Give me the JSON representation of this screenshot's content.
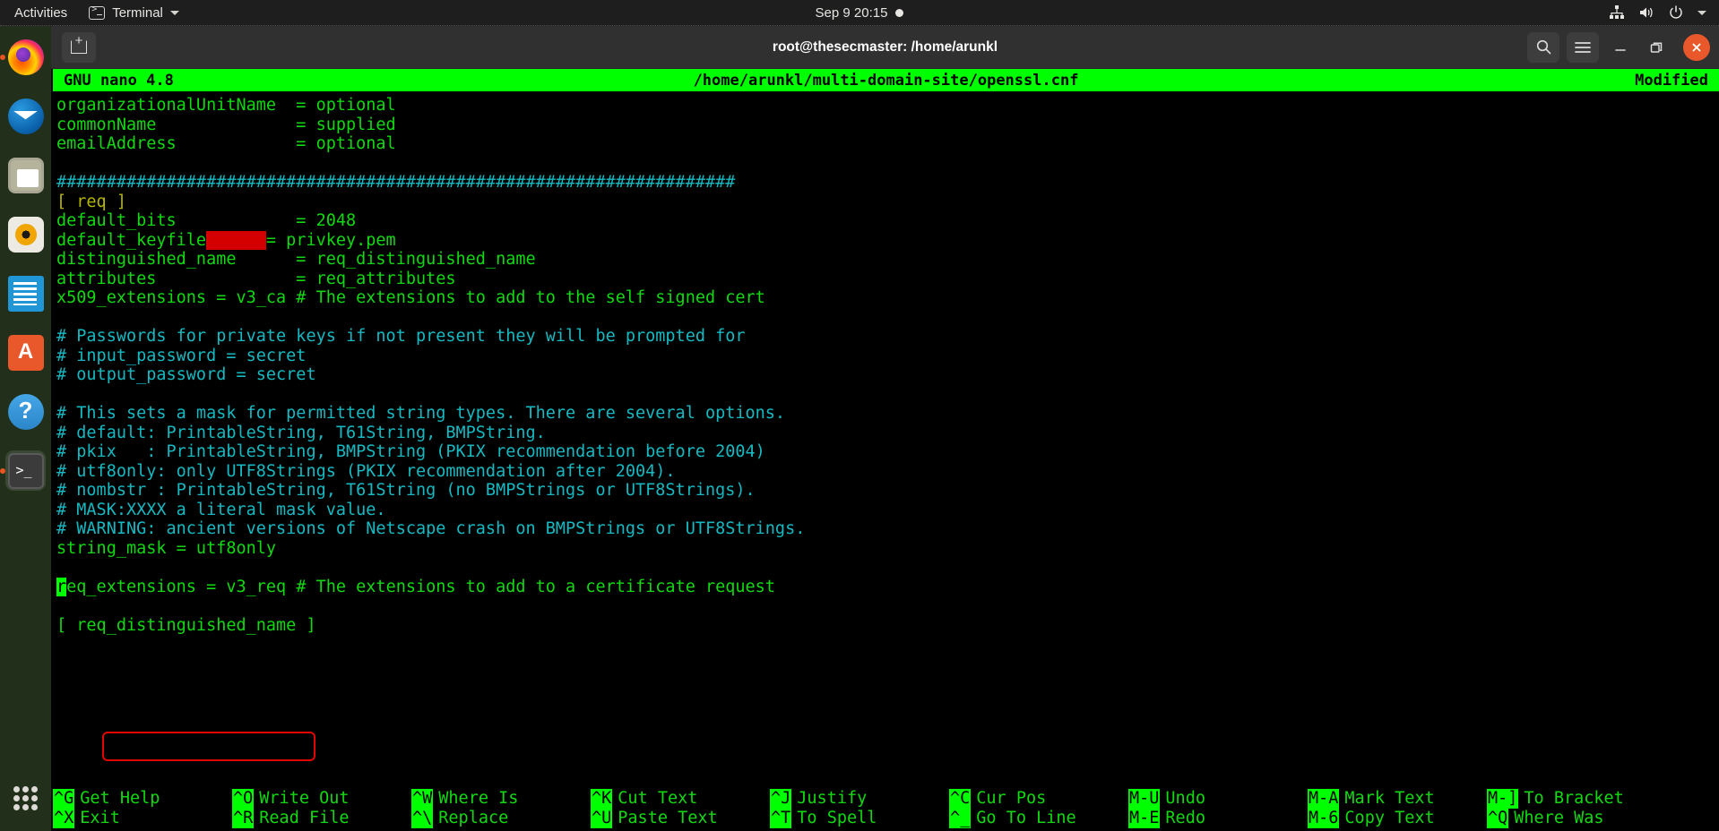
{
  "topbar": {
    "activities": "Activities",
    "app_name": "Terminal",
    "app_icon": "terminal-icon",
    "clock": "Sep 9  20:15",
    "recording_dot": "●",
    "icons": [
      "network-icon",
      "volume-icon",
      "power-icon",
      "chevron-down-icon"
    ]
  },
  "dock": {
    "items": [
      {
        "name": "firefox",
        "label": "Firefox",
        "running": true
      },
      {
        "name": "thunderbird",
        "label": "Thunderbird",
        "running": false
      },
      {
        "name": "files",
        "label": "Files",
        "running": false
      },
      {
        "name": "rhythmbox",
        "label": "Rhythmbox",
        "running": false
      },
      {
        "name": "libreoffice-writer",
        "label": "LibreOffice Writer",
        "running": false
      },
      {
        "name": "ubuntu-software",
        "label": "Ubuntu Software",
        "running": false
      },
      {
        "name": "help",
        "label": "Help",
        "running": false
      },
      {
        "name": "terminal",
        "label": "Terminal",
        "running": true
      }
    ],
    "show_apps_label": "Show Applications"
  },
  "window": {
    "title": "root@thesecmaster: /home/arunkl",
    "new_tab_label": "New Tab",
    "search_label": "Search",
    "menu_label": "Menu",
    "minimize_label": "Minimize",
    "maximize_label": "Restore",
    "close_label": "Close",
    "accent_close_color": "#e9582a"
  },
  "nano": {
    "version": "GNU nano 4.8",
    "filepath": "/home/arunkl/multi-domain-site/openssl.cnf",
    "status": "Modified",
    "header_bg": "#00ff00",
    "header_fg": "#000000",
    "lines": [
      {
        "segments": [
          {
            "text": "organizationalUnitName  = optional",
            "color": "green"
          }
        ]
      },
      {
        "segments": [
          {
            "text": "commonName              = supplied",
            "color": "green"
          }
        ]
      },
      {
        "segments": [
          {
            "text": "emailAddress            = optional",
            "color": "green"
          }
        ]
      },
      {
        "segments": [
          {
            "text": "",
            "color": "green"
          }
        ]
      },
      {
        "segments": [
          {
            "text": "####################################################################",
            "color": "cyan"
          }
        ]
      },
      {
        "segments": [
          {
            "text": "[ req ]",
            "color": "yellow"
          }
        ]
      },
      {
        "segments": [
          {
            "text": "default_bits            = 2048",
            "color": "green"
          }
        ]
      },
      {
        "segments": [
          {
            "text": "default_keyfile",
            "color": "green"
          },
          {
            "text": "      ",
            "color": "redacted"
          },
          {
            "text": "= privkey.pem",
            "color": "green"
          }
        ]
      },
      {
        "segments": [
          {
            "text": "distinguished_name      = req_distinguished_name",
            "color": "green"
          }
        ]
      },
      {
        "segments": [
          {
            "text": "attributes              = req_attributes",
            "color": "green"
          }
        ]
      },
      {
        "segments": [
          {
            "text": "x509_extensions = v3_ca # The extensions to add to the self signed cert",
            "color": "green"
          }
        ]
      },
      {
        "segments": [
          {
            "text": "",
            "color": "green"
          }
        ]
      },
      {
        "segments": [
          {
            "text": "# Passwords for private keys if not present they will be prompted for",
            "color": "cyan"
          }
        ]
      },
      {
        "segments": [
          {
            "text": "# input_password = secret",
            "color": "cyan"
          }
        ]
      },
      {
        "segments": [
          {
            "text": "# output_password = secret",
            "color": "cyan"
          }
        ]
      },
      {
        "segments": [
          {
            "text": "",
            "color": "green"
          }
        ]
      },
      {
        "segments": [
          {
            "text": "# This sets a mask for permitted string types. There are several options.",
            "color": "cyan"
          }
        ]
      },
      {
        "segments": [
          {
            "text": "# default: PrintableString, T61String, BMPString.",
            "color": "cyan"
          }
        ]
      },
      {
        "segments": [
          {
            "text": "# pkix   : PrintableString, BMPString (PKIX recommendation before 2004)",
            "color": "cyan"
          }
        ]
      },
      {
        "segments": [
          {
            "text": "# utf8only: only UTF8Strings (PKIX recommendation after 2004).",
            "color": "cyan"
          }
        ]
      },
      {
        "segments": [
          {
            "text": "# nombstr : PrintableString, T61String (no BMPStrings or UTF8Strings).",
            "color": "cyan"
          }
        ]
      },
      {
        "segments": [
          {
            "text": "# MASK:XXXX a literal mask value.",
            "color": "cyan"
          }
        ]
      },
      {
        "segments": [
          {
            "text": "# WARNING: ancient versions of Netscape crash on BMPStrings or UTF8Strings.",
            "color": "cyan"
          }
        ]
      },
      {
        "segments": [
          {
            "text": "string_mask = utf8only",
            "color": "green"
          }
        ]
      },
      {
        "segments": [
          {
            "text": "",
            "color": "green"
          }
        ]
      },
      {
        "segments": [
          {
            "text": "r",
            "color": "cursor"
          },
          {
            "text": "eq_extensions = v3_req",
            "color": "green"
          },
          {
            "text": " # The extensions to add to a certificate request",
            "color": "green"
          }
        ]
      },
      {
        "segments": [
          {
            "text": "",
            "color": "green"
          }
        ]
      },
      {
        "segments": [
          {
            "text": "[ req_distinguished_name ]",
            "color": "green"
          }
        ]
      }
    ],
    "highlight_box_color": "#e10600",
    "shortcuts_row1": [
      {
        "key": "^G",
        "label": "Get Help"
      },
      {
        "key": "^O",
        "label": "Write Out"
      },
      {
        "key": "^W",
        "label": "Where Is"
      },
      {
        "key": "^K",
        "label": "Cut Text"
      },
      {
        "key": "^J",
        "label": "Justify"
      },
      {
        "key": "^C",
        "label": "Cur Pos"
      },
      {
        "key": "M-U",
        "label": "Undo"
      },
      {
        "key": "M-A",
        "label": "Mark Text"
      },
      {
        "key": "M-]",
        "label": "To Bracket"
      }
    ],
    "shortcuts_row2": [
      {
        "key": "^X",
        "label": "Exit"
      },
      {
        "key": "^R",
        "label": "Read File"
      },
      {
        "key": "^\\",
        "label": "Replace"
      },
      {
        "key": "^U",
        "label": "Paste Text"
      },
      {
        "key": "^T",
        "label": "To Spell"
      },
      {
        "key": "^_",
        "label": "Go To Line"
      },
      {
        "key": "M-E",
        "label": "Redo"
      },
      {
        "key": "M-6",
        "label": "Copy Text"
      },
      {
        "key": "^Q",
        "label": "Where Was"
      }
    ]
  }
}
